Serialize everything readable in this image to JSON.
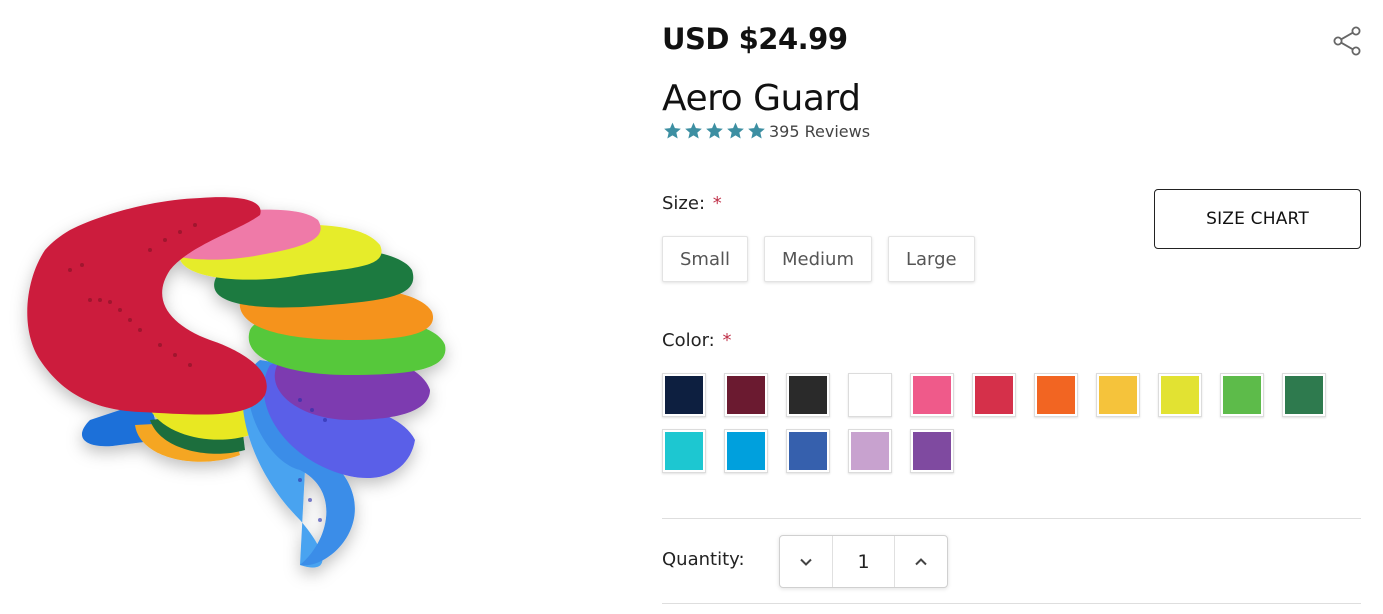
{
  "product": {
    "price": "USD $24.99",
    "title": "Aero Guard",
    "rating": 5,
    "reviews_label": "395 Reviews",
    "image_icon": "mouthguard-fan-image"
  },
  "share": {
    "icon": "share-icon"
  },
  "size_option": {
    "label": "Size:",
    "required_mark": "*",
    "options": [
      "Small",
      "Medium",
      "Large"
    ],
    "size_chart_label": "SIZE CHART"
  },
  "color_option": {
    "label": "Color:",
    "required_mark": "*",
    "swatches": [
      "#0d1f40",
      "#6b1a30",
      "#2a2a2a",
      "#ffffff",
      "#ef5a8a",
      "#d5304a",
      "#f26522",
      "#f5c33b",
      "#e2e232",
      "#5dbb4a",
      "#2e7a4e",
      "#1dc7d1",
      "#00a0dd",
      "#3660ad",
      "#c8a2cf",
      "#7f4aa0"
    ]
  },
  "quantity": {
    "label": "Quantity:",
    "value": "1",
    "decrement_icon": "chevron-down-icon",
    "increment_icon": "chevron-up-icon"
  },
  "colors": {
    "star": "#3d8fa2",
    "required": "#c0324a"
  }
}
